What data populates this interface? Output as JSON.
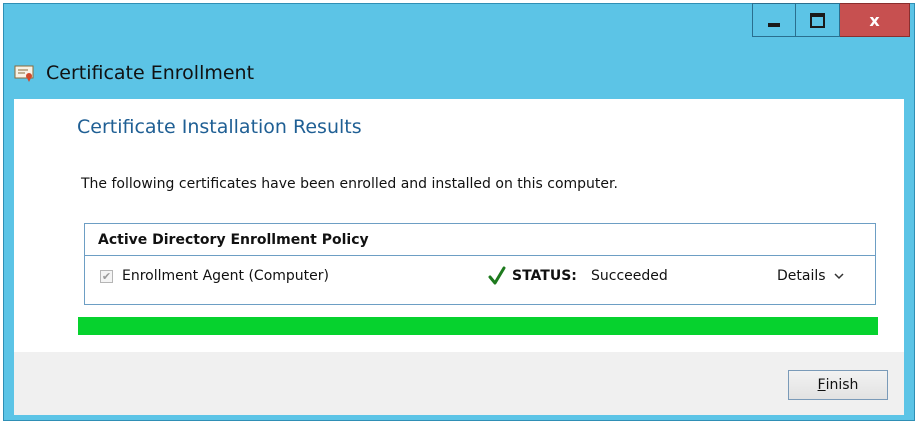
{
  "window": {
    "title": "Certificate Enrollment",
    "controls": {
      "minimize": "minimize-icon",
      "maximize": "maximize-icon",
      "close": "close-icon",
      "close_glyph": "x"
    }
  },
  "page": {
    "heading": "Certificate Installation Results",
    "description": "The following certificates have been enrolled and installed on this computer."
  },
  "policy": {
    "name": "Active Directory Enrollment Policy",
    "items": [
      {
        "checked": true,
        "name": "Enrollment Agent (Computer)",
        "status_label": "STATUS:",
        "status_value": "Succeeded",
        "details_label": "Details"
      }
    ]
  },
  "progress": {
    "value": 1.0,
    "color": "#06d22e"
  },
  "footer": {
    "finish_label": "Finish",
    "finish_access_key": "F",
    "finish_rest": "inish"
  },
  "colors": {
    "window_frame": "#5cc4e6",
    "close_button": "#c75050",
    "heading": "#1f5f94",
    "border": "#6d9ec4"
  }
}
